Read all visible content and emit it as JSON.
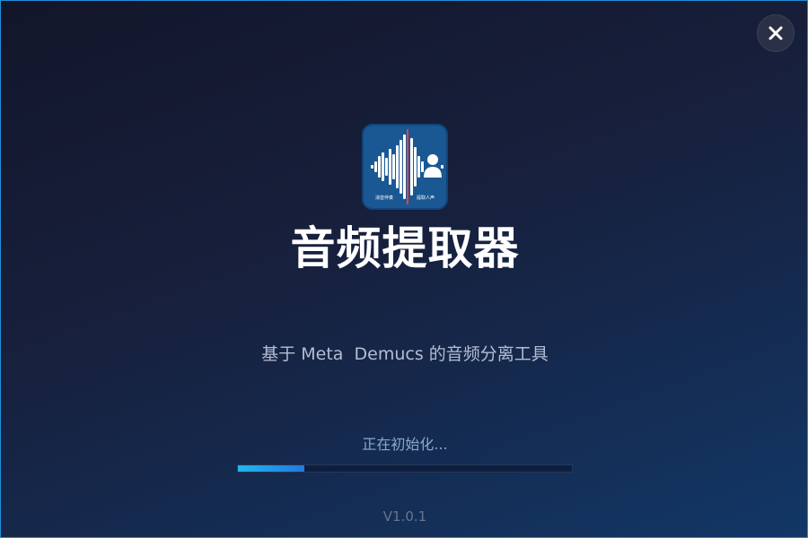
{
  "app": {
    "title": "音频提取器",
    "subtitle": "基于 Meta  Demucs 的音频分离工具",
    "icon": "waveform-person-icon",
    "icon_caption_left": "消音伴奏",
    "icon_caption_right": "提取人声"
  },
  "status": {
    "text": "正在初始化...",
    "progress": 0.2
  },
  "version": "V1.0.1",
  "window": {
    "close_icon": "close-icon"
  },
  "colors": {
    "accent": "#1fb8f0",
    "border": "#1f8fd8",
    "icon_bg": "#1a5893",
    "wave_line": "#e0424a"
  }
}
